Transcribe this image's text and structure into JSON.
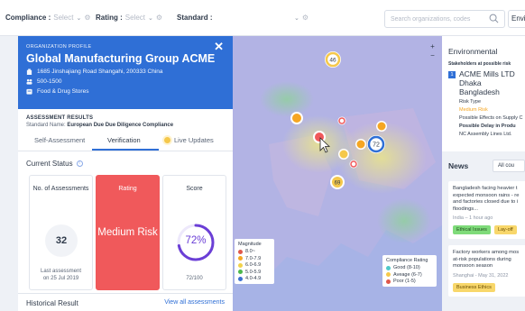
{
  "filters": {
    "compliance_label": "Compliance :",
    "compliance_value": "Select",
    "rating_label": "Rating :",
    "rating_value": "Select",
    "standard_label": "Standard :",
    "search_placeholder": "Search organizations, codes",
    "env_button": "Enviro"
  },
  "profile": {
    "section_label": "ORGANIZATION PROFILE",
    "name": "Global Manufacturing Group ACME",
    "address": "1685 Jinshajiang Road Shangahi, 200333 China",
    "employees": "500-1500",
    "category": "Food & Drug Stores"
  },
  "assessment": {
    "title": "ASSESSMENT RESULTS",
    "standard_prefix": "Standard Name:",
    "standard_name": "European Due Due Diligence Compliance",
    "tabs": [
      "Self-Assessment",
      "Verification",
      "Live Updates"
    ],
    "active_tab": "Verification"
  },
  "status": {
    "title": "Current Status",
    "assessments_title": "No. of Assessments",
    "assessments_count": "32",
    "last_assessment_label": "Last assessment",
    "last_assessment_date": "on 25 Jul 2019",
    "rating_title": "Rating",
    "rating_value": "Medium Risk",
    "score_title": "Score",
    "score_percent": "72%",
    "score_fraction": 0.72,
    "score_detail": "72/100"
  },
  "history": {
    "title": "Historical Result",
    "link": "View all assessments"
  },
  "map": {
    "zoom_in": "+",
    "zoom_out": "−",
    "clusters": [
      {
        "label": "46",
        "color": "#f5c84b"
      },
      {
        "label": "",
        "color": "#f0595b"
      },
      {
        "label": "",
        "color": "#f5a623"
      },
      {
        "label": "",
        "color": "#f5a623"
      },
      {
        "label": "",
        "color": "#f5a623"
      },
      {
        "label": "",
        "color": "#f5a623"
      },
      {
        "label": "72",
        "color": "#2f6fd6"
      },
      {
        "label": "",
        "color": "#f0595b"
      },
      {
        "label": "69",
        "color": "#f5c84b"
      }
    ],
    "magnitude_legend": {
      "title": "Magnitude",
      "items": [
        {
          "label": "8.0~",
          "color": "#e0584b"
        },
        {
          "label": "7.0-7.9",
          "color": "#f5a623"
        },
        {
          "label": "6.0-6.9",
          "color": "#f2d24b"
        },
        {
          "label": "5.0-5.9",
          "color": "#4cb84c"
        },
        {
          "label": "4.0-4.9",
          "color": "#3b6fd0"
        }
      ]
    },
    "compliance_legend": {
      "title": "Compliance Rating",
      "items": [
        {
          "label": "Good (8-10)",
          "color": "#4fc9c9"
        },
        {
          "label": "Aveage (6-7)",
          "color": "#f5c84b"
        },
        {
          "label": "Poor (1-5)",
          "color": "#e0584b"
        }
      ]
    }
  },
  "environmental": {
    "title": "Environmental",
    "subtitle": "Stakeholders at possible risk",
    "item_number": "1",
    "item_name": "ACME Mills LTD",
    "item_city": "Dhaka",
    "item_country": "Bangladesh",
    "risk_type_label": "Risk Type",
    "risk_type_value": "Medium Risk",
    "effects_label": "Possible Effects on Supply C",
    "effects_value": "Possible Delay in Produ",
    "effects_detail": "NC Assembly Lines Ltd."
  },
  "news": {
    "title": "News",
    "filter_button": "All cou",
    "items": [
      {
        "lines": [
          "Bangladesh facing heavier t",
          "expected monsoon rains - re",
          "and factories closed due to i",
          "floodings..."
        ],
        "meta": "India – 1 hour ago",
        "tags": [
          "Ethical Issues",
          "Lay-off"
        ]
      },
      {
        "lines": [
          "Factory workers among mos",
          "at-risk populations during",
          "monsoon season"
        ],
        "meta": "Shanghai - May 31, 2022",
        "tags": [
          "Business Ethics"
        ]
      }
    ]
  }
}
